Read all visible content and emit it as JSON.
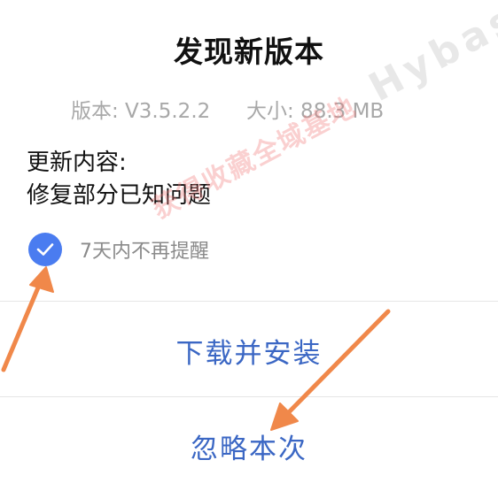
{
  "dialog": {
    "title": "发现新版本",
    "version": "版本: V3.5.2.2",
    "size": "大小: 88.3 MB",
    "changelog_heading": "更新内容:",
    "changelog_body": "修复部分已知问题",
    "remind_option": {
      "label": "7天内不再提醒",
      "checked": true
    },
    "install_button": "下载并安装",
    "ignore_button": "忽略本次"
  },
  "watermark": {
    "cn": "获得收藏全域基地",
    "en": "Hybase.com"
  },
  "colors": {
    "accent": "#4a7cf0",
    "action_text": "#3b67c4",
    "annotation_arrow": "#f0884a"
  }
}
